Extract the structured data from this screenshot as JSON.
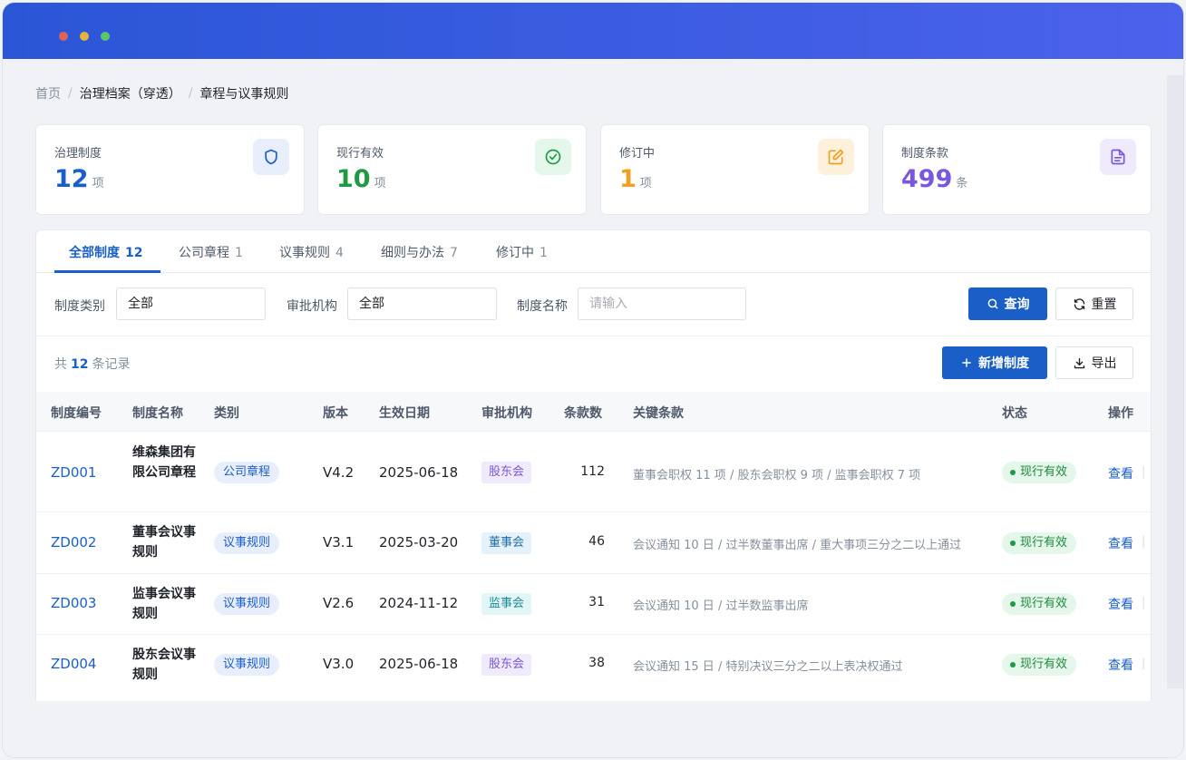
{
  "breadcrumb": {
    "home": "首页",
    "sep": "/",
    "middle": "治理档案（穿透）",
    "current": "章程与议事规则"
  },
  "stats": [
    {
      "label": "治理制度",
      "value": "12",
      "unit": "项",
      "color": "#1a5fc8",
      "icon": "shield-icon"
    },
    {
      "label": "现行有效",
      "value": "10",
      "unit": "项",
      "color": "#1f9a44",
      "icon": "check-circle-icon"
    },
    {
      "label": "修订中",
      "value": "1",
      "unit": "项",
      "color": "#f0a020",
      "icon": "edit-icon"
    },
    {
      "label": "制度条款",
      "value": "499",
      "unit": "条",
      "color": "#7a57e0",
      "icon": "document-icon"
    }
  ],
  "tabs": [
    {
      "label": "全部制度",
      "count": "12"
    },
    {
      "label": "公司章程",
      "count": "1"
    },
    {
      "label": "议事规则",
      "count": "4"
    },
    {
      "label": "细则与办法",
      "count": "7"
    },
    {
      "label": "修订中",
      "count": "1"
    }
  ],
  "filters": {
    "type_label": "制度类别",
    "type_value": "全部",
    "org_label": "审批机构",
    "org_value": "全部",
    "name_label": "制度名称",
    "name_placeholder": "请输入"
  },
  "buttons": {
    "search": "查询",
    "reset": "重置",
    "add": "新增制度",
    "export": "导出"
  },
  "total": {
    "prefix": "共",
    "count": "12",
    "suffix": "条记录"
  },
  "columns": [
    "制度编号",
    "制度名称",
    "类别",
    "版本",
    "生效日期",
    "审批机构",
    "条款数",
    "关键条款",
    "状态",
    "操作"
  ],
  "rows": [
    {
      "code": "ZD001",
      "name": "维森集团有限公司章程",
      "category": "公司章程",
      "version": "V4.2",
      "date": "2025-06-18",
      "org": "股东会",
      "clauses": "112",
      "key": "董事会职权 11 项 / 股东会职权 9 项 / 监事会职权 7 项",
      "status": "现行有效",
      "action": "查看"
    },
    {
      "code": "ZD002",
      "name": "董事会议事规则",
      "category": "议事规则",
      "version": "V3.1",
      "date": "2025-03-20",
      "org": "董事会",
      "clauses": "46",
      "key": "会议通知 10 日 / 过半数董事出席 / 重大事项三分之二以上通过",
      "status": "现行有效",
      "action": "查看"
    },
    {
      "code": "ZD003",
      "name": "监事会议事规则",
      "category": "议事规则",
      "version": "V2.6",
      "date": "2024-11-12",
      "org": "监事会",
      "clauses": "31",
      "key": "会议通知 10 日 / 过半数监事出席",
      "status": "现行有效",
      "action": "查看"
    },
    {
      "code": "ZD004",
      "name": "股东会议事规则",
      "category": "议事规则",
      "version": "V3.0",
      "date": "2025-06-18",
      "org": "股东会",
      "clauses": "38",
      "key": "会议通知 15 日 / 特别决议三分之二以上表决权通过",
      "status": "现行有效",
      "action": "查看"
    }
  ]
}
